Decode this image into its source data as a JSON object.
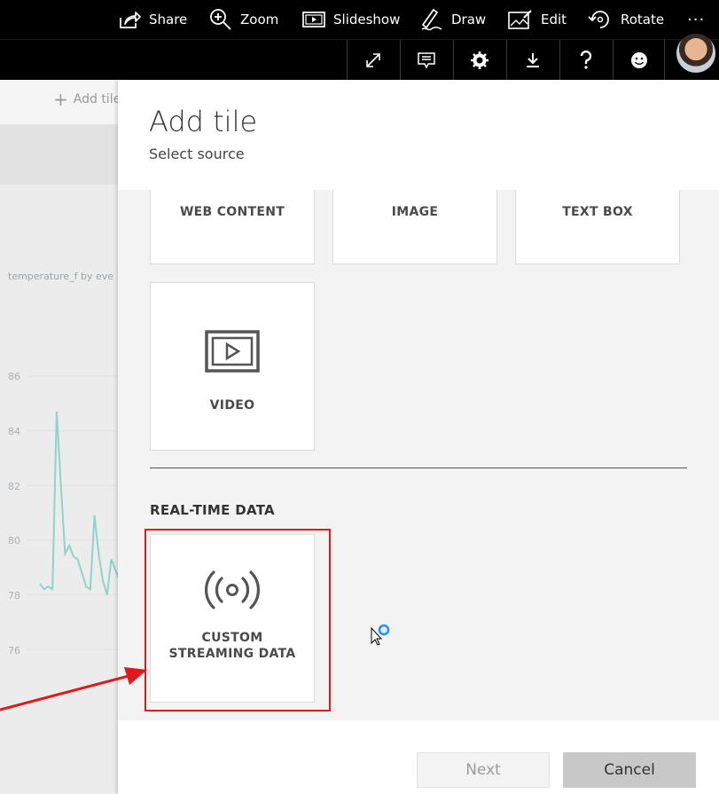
{
  "toolbar": {
    "share": "Share",
    "zoom": "Zoom",
    "slideshow": "Slideshow",
    "draw": "Draw",
    "edit": "Edit",
    "rotate": "Rotate",
    "more": "···"
  },
  "dashboard": {
    "add_tile_label": "Add tile",
    "chart_title": "temperature_f by eve",
    "y_ticks": [
      "86",
      "84",
      "82",
      "80",
      "78",
      "76"
    ]
  },
  "pane": {
    "title": "Add tile",
    "subtitle": "Select source",
    "media_tiles": [
      "WEB CONTENT",
      "IMAGE",
      "TEXT BOX",
      "VIDEO"
    ],
    "realtime_heading": "REAL-TIME DATA",
    "streaming_line1": "CUSTOM",
    "streaming_line2": "STREAMING DATA",
    "next_label": "Next",
    "cancel_label": "Cancel"
  },
  "chart_data": {
    "type": "line",
    "title": "temperature_f by eve",
    "ylim": [
      75,
      87
    ],
    "y_ticks": [
      76,
      78,
      80,
      82,
      84,
      86
    ],
    "series": [
      {
        "values": [
          78.4,
          78.2,
          78.3,
          78.2,
          84.7,
          82.0,
          79.5,
          79.8,
          79.4,
          79.3,
          78.8,
          78.3,
          78.2,
          80.9,
          79.5,
          78.5,
          78.0,
          79.3,
          78.9,
          78.5
        ]
      }
    ]
  },
  "colors": {
    "accent_red": "#e01919",
    "line": "#8fd3cb"
  }
}
